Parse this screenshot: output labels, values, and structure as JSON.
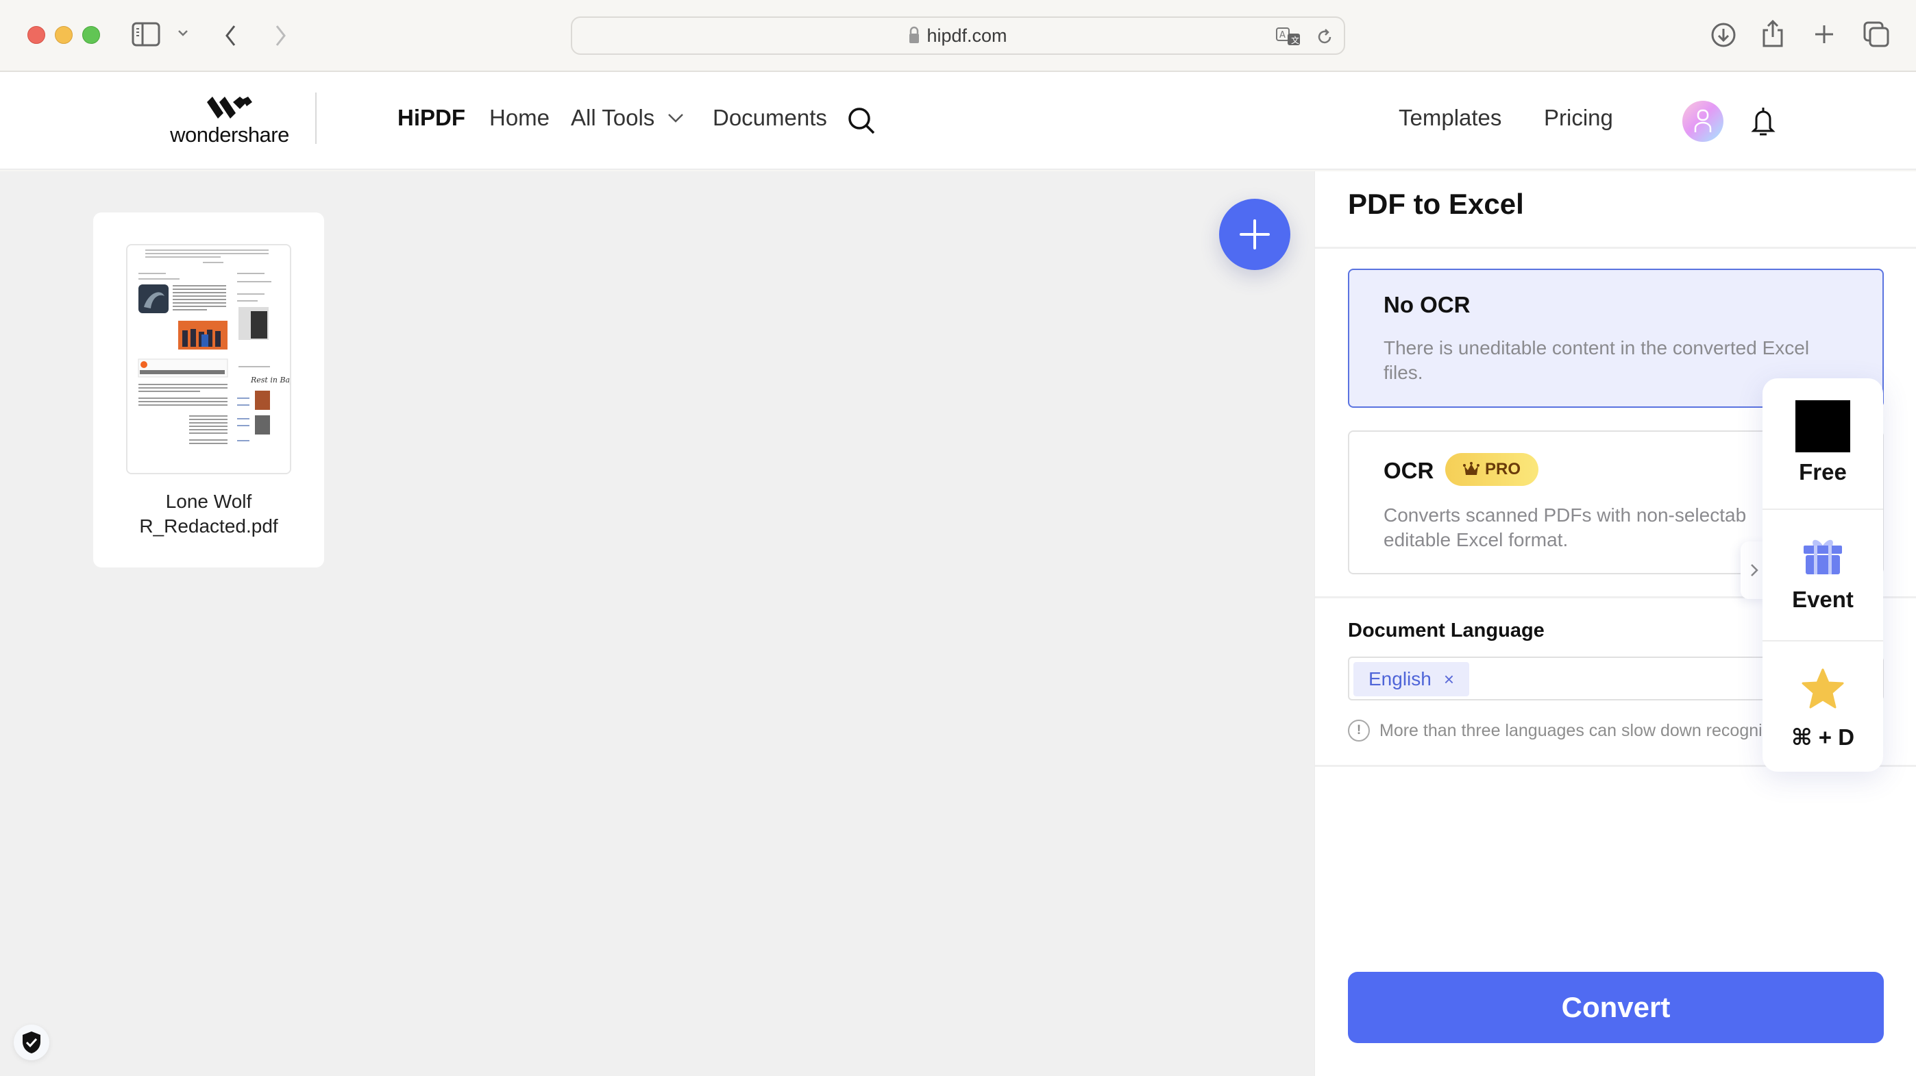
{
  "browser": {
    "url": "hipdf.com",
    "icons": {
      "sidebar": "sidebar-toggle-icon",
      "chevron": "chevron-down-icon",
      "back": "back-arrow-icon",
      "forward": "forward-arrow-icon",
      "lock": "lock-icon",
      "translate": "translate-icon",
      "reload": "reload-icon",
      "download": "download-icon",
      "share": "share-icon",
      "new_tab": "plus-icon",
      "tabs": "tab-overview-icon"
    }
  },
  "header": {
    "logo_text": "wondershare",
    "brand": "HiPDF",
    "nav": {
      "home": "Home",
      "all_tools": "All Tools",
      "documents": "Documents",
      "templates": "Templates",
      "pricing": "Pricing"
    }
  },
  "workspace": {
    "files": [
      {
        "name_line1": "Lone Wolf",
        "name_line2": "R_Redacted.pdf"
      }
    ],
    "add_button_icon": "plus-icon",
    "security_icon": "shield-check-icon"
  },
  "panel": {
    "title": "PDF to Excel",
    "options": [
      {
        "title": "No OCR",
        "description": "There is uneditable content in the converted Excel files.",
        "selected": true
      },
      {
        "title": "OCR",
        "badge": "PRO",
        "description": "Converts scanned PDFs with non-selectab editable Excel format.",
        "description_line1": "Converts scanned PDFs with non-selectab",
        "description_line2": "editable Excel format.",
        "selected": false
      }
    ],
    "language": {
      "label": "Document Language",
      "selected": [
        "English"
      ],
      "remove_symbol": "×",
      "hint": "More than three languages can slow down recognit",
      "hint_icon_symbol": "!"
    },
    "convert_label": "Convert"
  },
  "float_widget": {
    "items": [
      {
        "label": "Free",
        "icon": "black-square-icon"
      },
      {
        "label": "Event",
        "icon": "gift-icon"
      },
      {
        "label": "⌘ + D",
        "icon": "star-icon"
      }
    ]
  },
  "colors": {
    "accent": "#506bf2",
    "selected_bg": "#eceefd",
    "selected_border": "#5a73e0",
    "pro_badge": "#f5cf57",
    "star": "#f4c44a",
    "gift": "#6b7ff0"
  }
}
